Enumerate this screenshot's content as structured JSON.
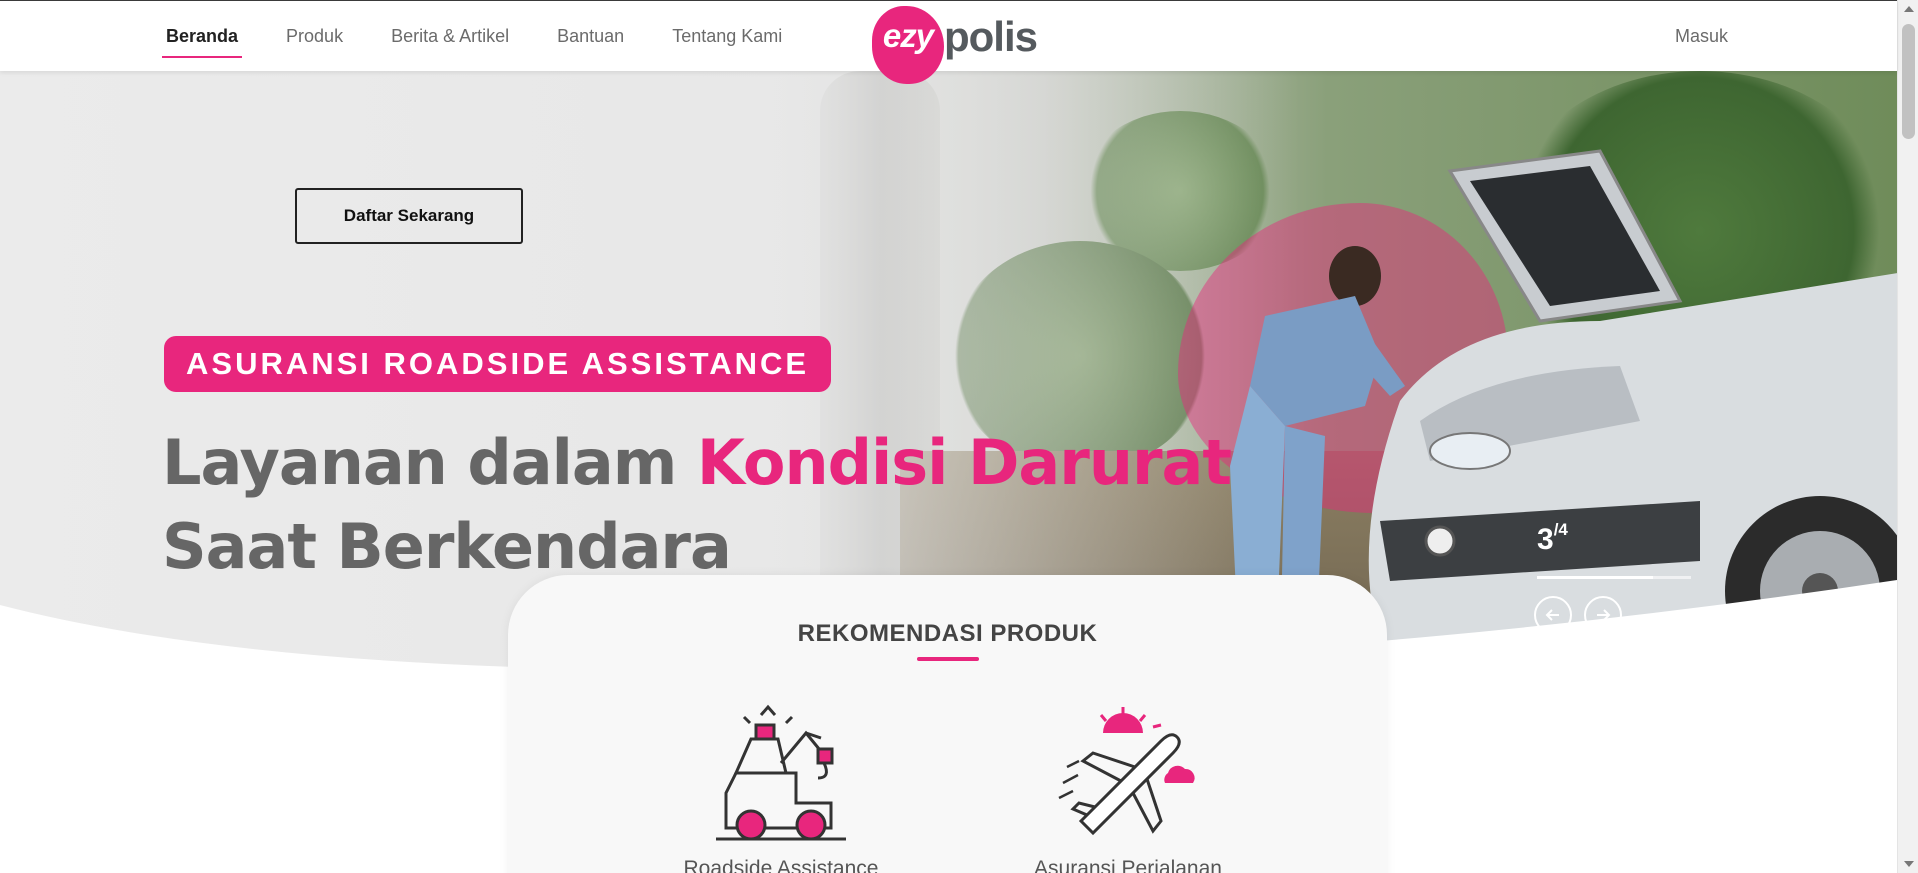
{
  "nav": {
    "items": [
      {
        "label": "Beranda",
        "active": true
      },
      {
        "label": "Produk",
        "active": false
      },
      {
        "label": "Berita & Artikel",
        "active": false
      },
      {
        "label": "Bantuan",
        "active": false
      },
      {
        "label": "Tentang Kami",
        "active": false
      }
    ],
    "logo": {
      "part1": "ezy",
      "part2": "polis"
    },
    "login_label": "Masuk"
  },
  "hero": {
    "cta_label": "Daftar Sekarang",
    "tag": "ASURANSI ROADSIDE ASSISTANCE",
    "headline_part1": "Layanan dalam ",
    "headline_highlight": "Kondisi Darurat",
    "headline_line2": "Saat Berkendara",
    "slide_current": "3",
    "slide_total": "/4",
    "slide_progress": 0.75,
    "prev_icon": "arrow-left-icon",
    "next_icon": "arrow-right-icon"
  },
  "recommendations": {
    "title": "REKOMENDASI PRODUK",
    "products": [
      {
        "label": "Roadside Assistance",
        "icon": "tow-truck-icon"
      },
      {
        "label": "Asuransi Perjalanan",
        "icon": "airplane-icon"
      }
    ]
  },
  "colors": {
    "accent": "#e8267d",
    "text_dark": "#444444",
    "text_nav": "#6b6b6b",
    "headline_gray": "#666666"
  }
}
